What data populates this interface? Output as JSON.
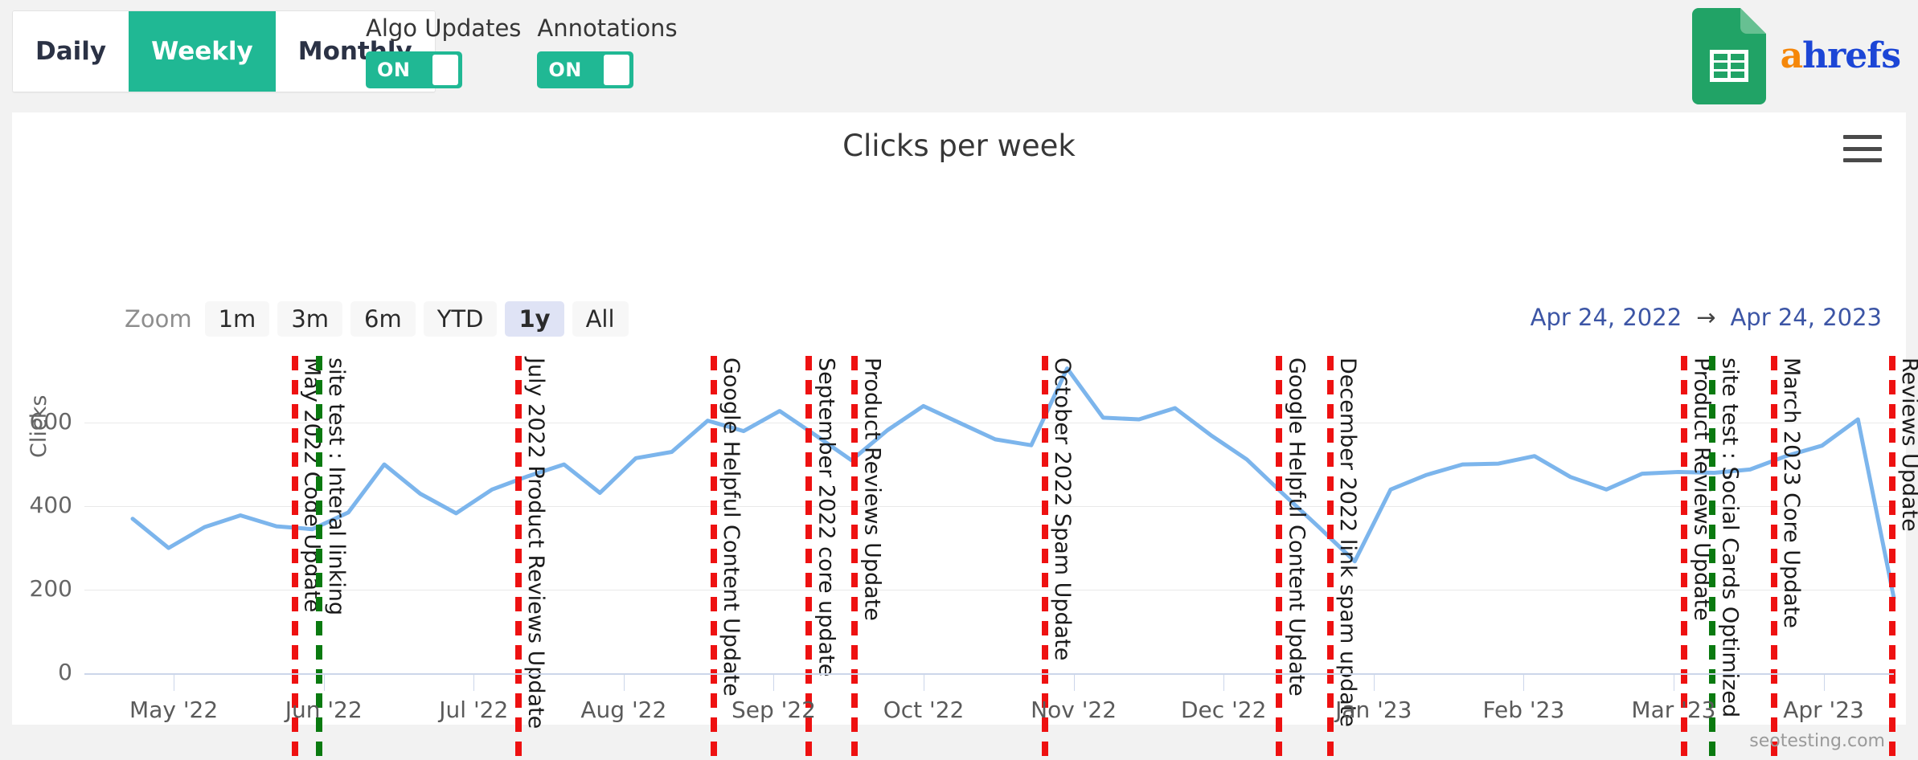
{
  "toolbar": {
    "granularity": [
      {
        "label": "Daily",
        "active": false
      },
      {
        "label": "Weekly",
        "active": true
      },
      {
        "label": "Monthly",
        "active": false
      }
    ],
    "toggles": [
      {
        "label": "Algo Updates",
        "state": "ON"
      },
      {
        "label": "Annotations",
        "state": "ON"
      }
    ],
    "brand": {
      "name_a": "a",
      "name_rest": "hrefs",
      "icon": "google-sheets-icon"
    }
  },
  "chart_panel": {
    "title": "Clicks per week",
    "menu_icon": "hamburger-menu-icon",
    "zoom_label": "Zoom",
    "zoom_options": [
      {
        "label": "1m",
        "selected": false
      },
      {
        "label": "3m",
        "selected": false
      },
      {
        "label": "6m",
        "selected": false
      },
      {
        "label": "YTD",
        "selected": false
      },
      {
        "label": "1y",
        "selected": true
      },
      {
        "label": "All",
        "selected": false
      }
    ],
    "date_from": "Apr 24, 2022",
    "date_arrow": "→",
    "date_to": "Apr 24, 2023",
    "watermark": "seotesting.com"
  },
  "colors": {
    "accent_green": "#20b894",
    "line_blue": "#7cb5ec",
    "algo_update_red": "#ee1111",
    "annotation_green": "#0a7a10",
    "date_link_blue": "#3c55a5",
    "zoom_selected_bg": "#dfe3f5"
  },
  "chart_data": {
    "type": "line",
    "title": "Clicks per week",
    "xlabel": "",
    "ylabel": "Clicks",
    "ylim": [
      0,
      760
    ],
    "yticks": [
      0,
      200,
      400,
      600
    ],
    "grid": true,
    "legend": "none",
    "xtick_labels": [
      "May '22",
      "Jun '22",
      "Jul '22",
      "Aug '22",
      "Sep '22",
      "Oct '22",
      "Nov '22",
      "Dec '22",
      "Jan '23",
      "Feb '23",
      "Mar '23",
      "Apr '23"
    ],
    "series": [
      {
        "name": "Clicks",
        "color": "#7cb5ec",
        "values": [
          370,
          300,
          350,
          378,
          352,
          345,
          385,
          500,
          430,
          383,
          440,
          472,
          500,
          432,
          515,
          530,
          605,
          580,
          628,
          570,
          510,
          582,
          640,
          600,
          560,
          546,
          730,
          612,
          608,
          635,
          570,
          512,
          430,
          350,
          268,
          440,
          475,
          500,
          502,
          520,
          470,
          440,
          478,
          482,
          480,
          488,
          520,
          545,
          608,
          180
        ]
      }
    ]
  },
  "annotations": [
    {
      "label": "May 2022 Code Update",
      "type": "algo-update",
      "color": "red",
      "x_pct": 9.2
    },
    {
      "label": "site test : Interal linking",
      "type": "site-test",
      "color": "green",
      "x_pct": 10.6
    },
    {
      "label": "July 2022 Product Reviews Update",
      "type": "algo-update",
      "color": "red",
      "x_pct": 21.9
    },
    {
      "label": "Google Helpful Content Update",
      "type": "algo-update",
      "color": "red",
      "x_pct": 33.0
    },
    {
      "label": "September 2022 core update",
      "type": "algo-update",
      "color": "red",
      "x_pct": 38.4
    },
    {
      "label": "Product Reviews Update",
      "type": "algo-update",
      "color": "red",
      "x_pct": 41.0
    },
    {
      "label": "October 2022 Spam Update",
      "type": "algo-update",
      "color": "red",
      "x_pct": 51.8
    },
    {
      "label": "Google Helpful Content Update",
      "type": "algo-update",
      "color": "red",
      "x_pct": 65.1
    },
    {
      "label": "December 2022 link spam update",
      "type": "algo-update",
      "color": "red",
      "x_pct": 68.0
    },
    {
      "label": "Product Reviews Update",
      "type": "algo-update",
      "color": "red",
      "x_pct": 88.1
    },
    {
      "label": "site test : Social Cards Optimized",
      "type": "site-test",
      "color": "green",
      "x_pct": 89.7
    },
    {
      "label": "March 2023 Core Update",
      "type": "algo-update",
      "color": "red",
      "x_pct": 93.2
    },
    {
      "label": "Reviews Update",
      "type": "algo-update",
      "color": "red",
      "x_pct": 99.9
    }
  ]
}
